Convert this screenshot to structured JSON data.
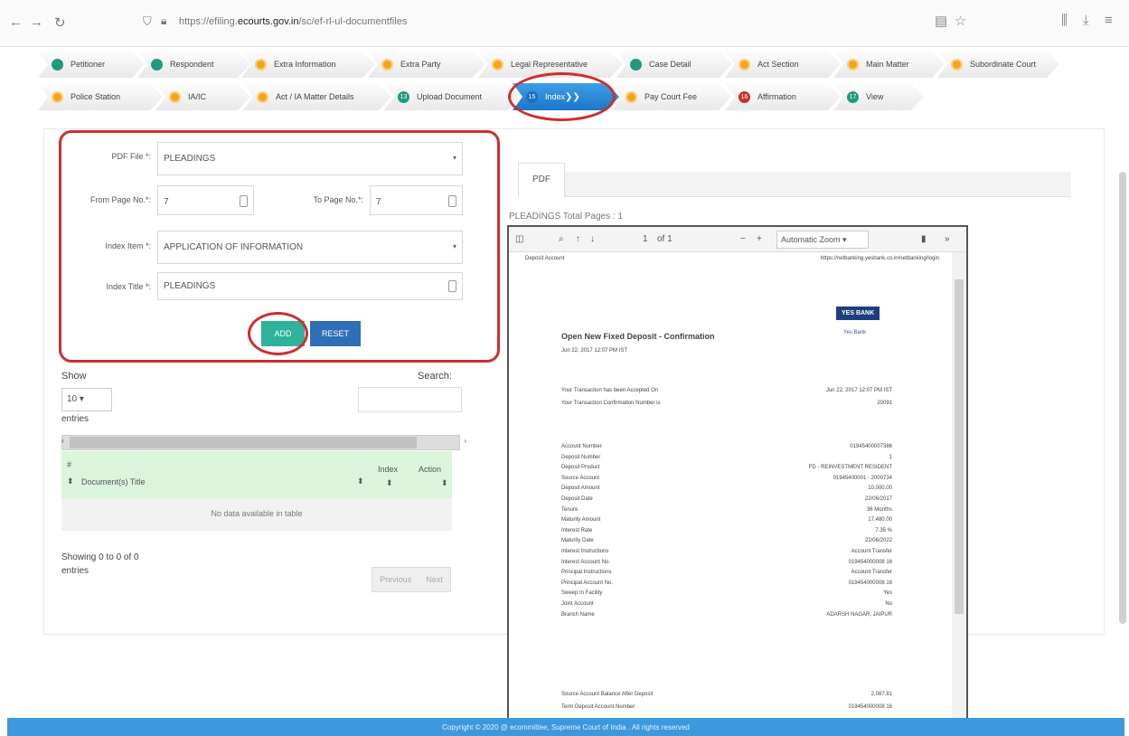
{
  "browser": {
    "url_prefix": "https://efiling.",
    "url_host": "ecourts.gov.in",
    "url_rest": "/sc/ef-rl-ul-documentfiles",
    "icons": [
      "back-icon",
      "forward-icon",
      "reload-icon",
      "shield-icon",
      "lock-icon",
      "reader-icon",
      "bookmark-star-icon",
      "library-icon",
      "download-icon",
      "menu-icon"
    ]
  },
  "steps_row1": [
    {
      "label": "Petitioner",
      "color": "g"
    },
    {
      "label": "Respondent",
      "color": "g"
    },
    {
      "label": "Extra Information",
      "color": "o"
    },
    {
      "label": "Extra Party",
      "color": "o"
    },
    {
      "label": "Legal Representative",
      "color": "o"
    },
    {
      "label": "Case Detail",
      "color": "g"
    },
    {
      "label": "Act Section",
      "color": "o"
    },
    {
      "label": "Main Matter",
      "color": "o"
    },
    {
      "label": "Subordinate Court",
      "color": "o"
    }
  ],
  "steps_row2": [
    {
      "label": "Police Station",
      "color": "o"
    },
    {
      "label": "IA/IC",
      "color": "o"
    },
    {
      "label": "Act / IA Matter Details",
      "color": "o"
    },
    {
      "label": "Upload Document",
      "color": "g",
      "num": "13"
    },
    {
      "label": "Index",
      "color": "active",
      "num": "15"
    },
    {
      "label": "Pay Court Fee",
      "color": "o"
    },
    {
      "label": "Affirmation",
      "color": "r",
      "num": "16"
    },
    {
      "label": "View",
      "color": "g",
      "num": "17"
    }
  ],
  "form": {
    "pdf_file_label": "PDF File *:",
    "pdf_file_value": "PLEADINGS",
    "from_page_label": "From Page No.*:",
    "from_page_value": "7",
    "to_page_label": "To Page No.*:",
    "to_page_value": "7",
    "index_item_label": "Index Item *:",
    "index_item_value": "APPLICATION OF INFORMATION",
    "index_title_label": "Index Title *:",
    "index_title_value": "PLEADINGS",
    "add_label": "ADD",
    "reset_label": "RESET"
  },
  "table": {
    "show_label": "Show",
    "show_value": "10",
    "entries_label": "entries",
    "search_label": "Search:",
    "col_num": "#",
    "col_title": "Document(s) Title",
    "col_index": "Index",
    "col_action": "Action",
    "empty_text": "No data available in table",
    "info_line1": "Showing 0 to 0 of 0",
    "info_line2": "entries",
    "prev_label": "Previous",
    "next_label": "Next"
  },
  "pdf": {
    "tab_label": "PDF",
    "caption": "PLEADINGS Total Pages : 1",
    "page_value": "1",
    "page_of": "of 1",
    "zoom": "Automatic Zoom",
    "header_left": "Deposit Account",
    "header_right": "https://netbanking.yesbank.co.in/netbanking/login",
    "bank_logo": "YES BANK",
    "bank_tag": "Yes Bank",
    "title": "Open New Fixed Deposit - Confirmation",
    "subtitle": "Jun 22, 2017 12:07 PM IST",
    "rows_top": [
      {
        "label": "Your Transaction has been Accepted On",
        "value": "Jun 22, 2017 12:07 PM IST"
      },
      {
        "label": "Your Transaction Confirmation Number is",
        "value": "20091"
      }
    ],
    "rows": [
      {
        "label": "Account Number",
        "value": "01945400007386"
      },
      {
        "label": "Deposit Number",
        "value": "1"
      },
      {
        "label": "Deposit Product",
        "value": "FD - REINVESTMENT RESIDENT"
      },
      {
        "label": "Source Account",
        "value": "01945400001 - 2000734"
      },
      {
        "label": "Deposit Amount",
        "value": "10,000.00"
      },
      {
        "label": "Deposit Date",
        "value": "22/06/2017"
      },
      {
        "label": "Tenure",
        "value": "36 Months"
      },
      {
        "label": "Maturity Amount",
        "value": "17,480.00"
      },
      {
        "label": "Interest Rate",
        "value": "7.35 %"
      },
      {
        "label": "Maturity Date",
        "value": "22/06/2022"
      },
      {
        "label": "Interest Instructions",
        "value": "Account Transfer"
      },
      {
        "label": "Interest Account No.",
        "value": "019454000008 16"
      },
      {
        "label": "Principal Instructions",
        "value": "Account Transfer"
      },
      {
        "label": "Principal Account No.",
        "value": "019454000008 16"
      },
      {
        "label": "Sweep In Facility",
        "value": "Yes"
      },
      {
        "label": "Joint Account",
        "value": "No"
      },
      {
        "label": "Branch Name",
        "value": "ADARSH NAGAR, JAIPUR"
      }
    ],
    "rows_bottom": [
      {
        "label": "Source Account Balance After Deposit",
        "value": "2,087.81"
      },
      {
        "label": "Term Deposit Account Number",
        "value": "019454000008 16"
      }
    ]
  },
  "footer": "Copyright © 2020 @ ecommittee, Supreme Court of India . All rights reserved"
}
